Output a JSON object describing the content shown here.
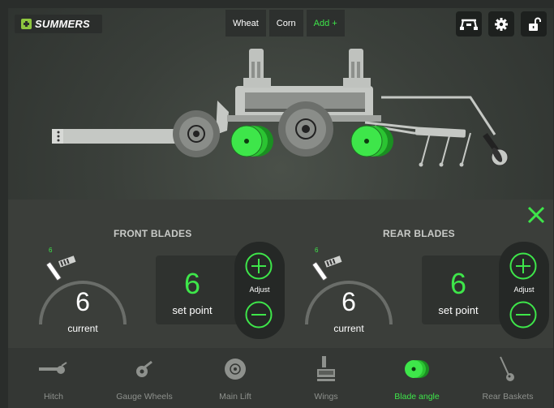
{
  "brand": {
    "logo_text": "SUMMERS"
  },
  "crops": [
    {
      "label": "Wheat"
    },
    {
      "label": "Corn"
    },
    {
      "label": "Add +"
    }
  ],
  "top_icons": [
    "hitch-view-icon",
    "gear-icon",
    "unlock-icon"
  ],
  "front_blades": {
    "title": "FRONT BLADES",
    "current_value": "6",
    "current_label": "current",
    "marker_value": "6",
    "set_point_value": "6",
    "set_point_label": "set point",
    "adjust_label": "Adjust"
  },
  "rear_blades": {
    "title": "REAR BLADES",
    "current_value": "6",
    "current_label": "current",
    "marker_value": "6",
    "set_point_value": "6",
    "set_point_label": "set point",
    "adjust_label": "Adjust"
  },
  "tabs": [
    {
      "label": "Hitch",
      "icon": "hitch-icon",
      "active": false
    },
    {
      "label": "Gauge Wheels",
      "icon": "gauge-wheel-icon",
      "active": false
    },
    {
      "label": "Main Lift",
      "icon": "main-lift-icon",
      "active": false
    },
    {
      "label": "Wings",
      "icon": "wings-icon",
      "active": false
    },
    {
      "label": "Blade angle",
      "icon": "blade-angle-icon",
      "active": true
    },
    {
      "label": "Rear Baskets",
      "icon": "rear-baskets-icon",
      "active": false
    }
  ],
  "colors": {
    "accent": "#3ee64a",
    "panel": "#3b3e3a",
    "tab_bar": "#343734"
  }
}
